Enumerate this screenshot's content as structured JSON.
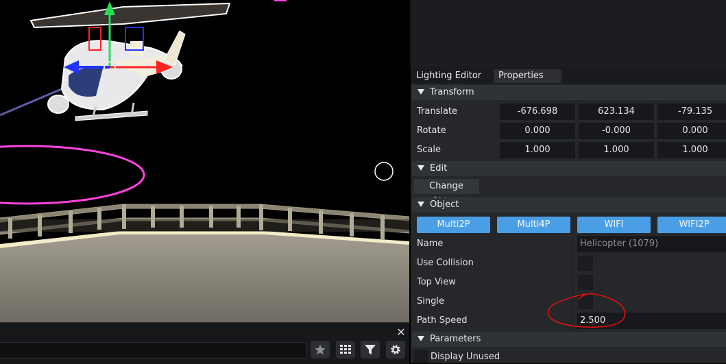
{
  "viewport": {
    "footer": {
      "close_glyph": "✕",
      "search_value": "",
      "buttons": [
        {
          "icon": "star-icon"
        },
        {
          "icon": "grid-icon"
        },
        {
          "icon": "filter-icon"
        },
        {
          "icon": "gear-icon"
        }
      ]
    },
    "colors": {
      "background": "#000000",
      "path_ring": "#ff44e0",
      "gizmo_x": "#ff2222",
      "gizmo_y": "#22e055",
      "gizmo_z": "#2233ff",
      "floor": "#8f8a7d"
    }
  },
  "panel": {
    "tabs": [
      {
        "label": "Lighting Editor",
        "active": false
      },
      {
        "label": "Properties",
        "active": true
      }
    ],
    "transform": {
      "header": "Transform",
      "rows": [
        {
          "label": "Translate",
          "values": [
            "-676.698",
            "623.134",
            "-79.135"
          ]
        },
        {
          "label": "Rotate",
          "values": [
            "0.000",
            "-0.000",
            "0.000"
          ]
        },
        {
          "label": "Scale",
          "values": [
            "1.000",
            "1.000",
            "1.000"
          ]
        }
      ]
    },
    "edit": {
      "header": "Edit",
      "change_object_label": "Change Object"
    },
    "object": {
      "header": "Object",
      "mode_buttons": [
        "Multi2P",
        "Multi4P",
        "WIFI",
        "WIFI2P"
      ],
      "name_label": "Name",
      "name_value": "Helicopter (1079)",
      "use_collision_label": "Use Collision",
      "use_collision": false,
      "top_view_label": "Top View",
      "top_view": false,
      "single_label": "Single",
      "single": false,
      "path_speed_label": "Path Speed",
      "path_speed_value": "2.500"
    },
    "parameters": {
      "header": "Parameters",
      "display_unused_label": "Display Unused",
      "display_unused": false
    },
    "colors": {
      "accent_button": "#4a9ee6",
      "annotation": "#e01010"
    }
  }
}
